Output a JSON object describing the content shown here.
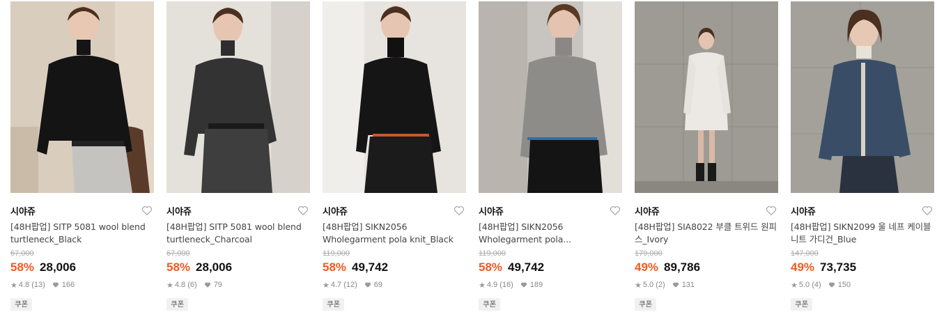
{
  "colors": {
    "discount": "#f05a22"
  },
  "coupon_label": "쿠폰",
  "products": [
    {
      "brand": "시야쥬",
      "name": "[48H팝업] SITP 5081 wool blend turtleneck_Black",
      "original_price": "67,000",
      "discount": "58%",
      "price": "28,006",
      "rating": "4.8",
      "reviews": "(13)",
      "likes": "166"
    },
    {
      "brand": "시야쥬",
      "name": "[48H팝업] SITP 5081 wool blend turtleneck_Charcoal",
      "original_price": "67,000",
      "discount": "58%",
      "price": "28,006",
      "rating": "4.8",
      "reviews": "(6)",
      "likes": "79"
    },
    {
      "brand": "시야쥬",
      "name": "[48H팝업] SIKN2056 Wholegarment pola knit_Black",
      "original_price": "119,000",
      "discount": "58%",
      "price": "49,742",
      "rating": "4.7",
      "reviews": "(12)",
      "likes": "69"
    },
    {
      "brand": "시야쥬",
      "name": "[48H팝업] SIKN2056 Wholegarment pola...",
      "original_price": "119,000",
      "discount": "58%",
      "price": "49,742",
      "rating": "4.9",
      "reviews": "(16)",
      "likes": "189"
    },
    {
      "brand": "시야쥬",
      "name": "[48H팝업] SIA8022 부클 트위드 원피스_Ivory",
      "original_price": "179,000",
      "discount": "49%",
      "price": "89,786",
      "rating": "5.0",
      "reviews": "(2)",
      "likes": "131"
    },
    {
      "brand": "시야쥬",
      "name": "[48H팝업] SIKN2099 울 네프 케이블 니트 가디건_Blue",
      "original_price": "147,000",
      "discount": "49%",
      "price": "73,735",
      "rating": "5.0",
      "reviews": "(4)",
      "likes": "150"
    }
  ]
}
